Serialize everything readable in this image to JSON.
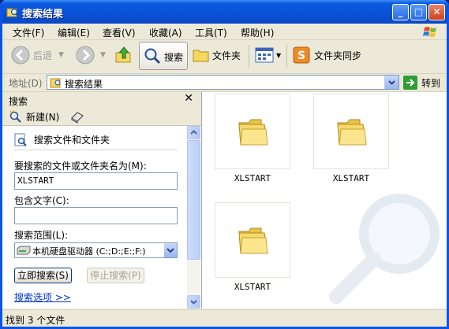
{
  "window": {
    "title": "搜索结果"
  },
  "menu": [
    "文件(F)",
    "编辑(E)",
    "查看(V)",
    "收藏(A)",
    "工具(T)",
    "帮助(H)"
  ],
  "toolbar": {
    "back": "后退",
    "search": "搜索",
    "folders": "文件夹",
    "sync": "文件夹同步"
  },
  "address": {
    "label": "地址(D)",
    "value": "搜索结果",
    "go": "转到"
  },
  "search_pane": {
    "title": "搜索",
    "new_label": "新建(N)",
    "heading": "搜索文件和文件夹",
    "name_label": "要搜索的文件或文件夹名为(M):",
    "name_value": "XLSTART",
    "contains_label": "包含文字(C):",
    "contains_value": "",
    "lookin_label": "搜索范围(L):",
    "lookin_value": "本机硬盘驱动器 (C:;D:;E:;F:)",
    "search_now": "立即搜索(S)",
    "stop": "停止搜索(P)",
    "options": "搜索选项 >>"
  },
  "results": [
    {
      "name": "XLSTART"
    },
    {
      "name": "XLSTART"
    },
    {
      "name": "XLSTART"
    }
  ],
  "status": {
    "text": "找到 3 个文件"
  }
}
